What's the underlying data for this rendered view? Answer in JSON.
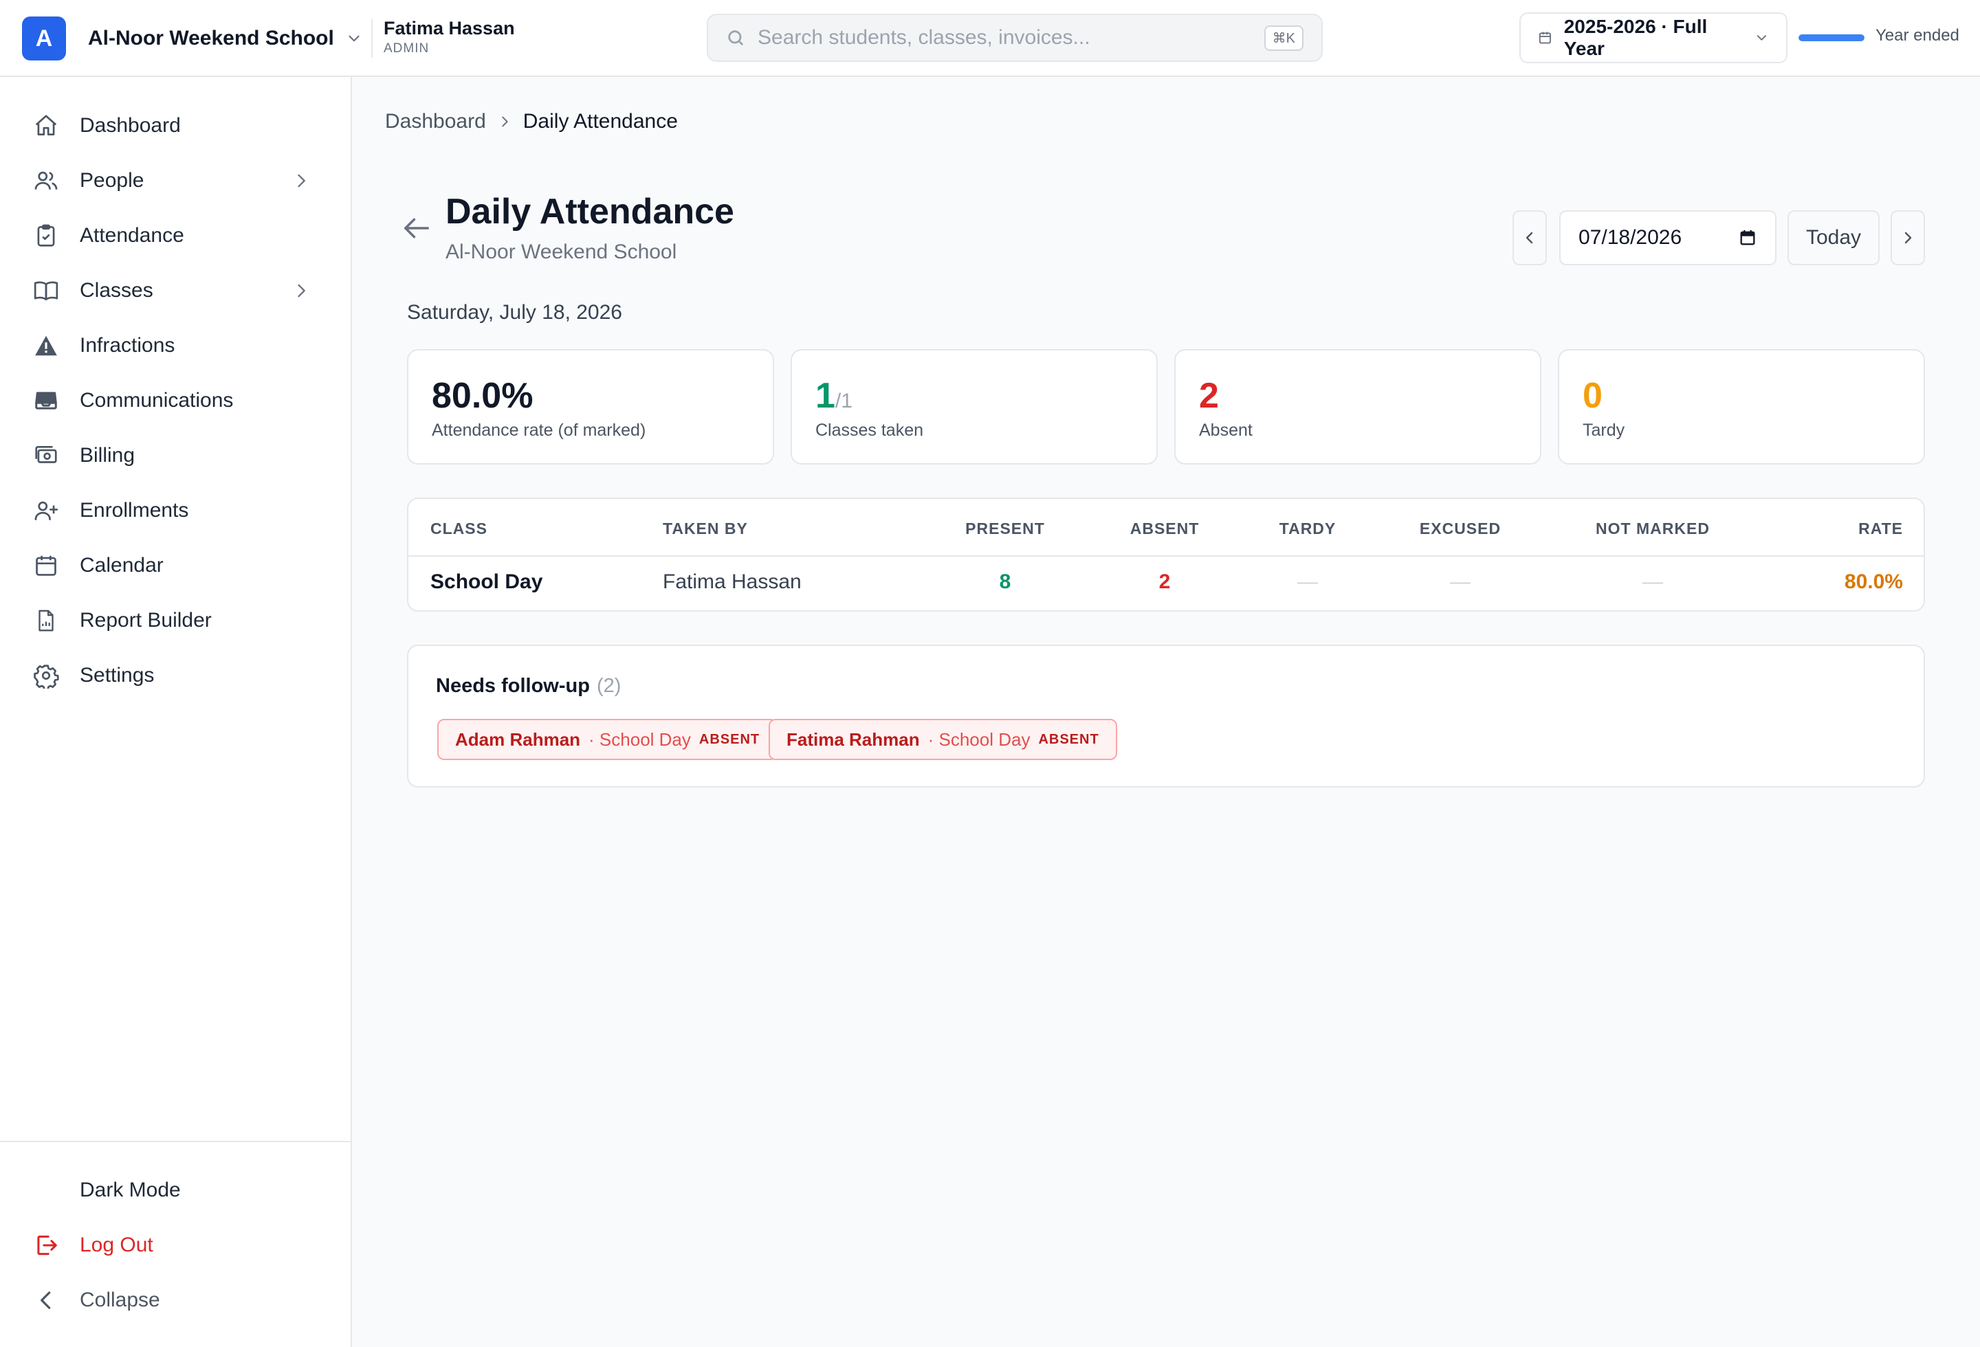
{
  "app": {
    "logo_letter": "A",
    "school_name": "Al-Noor Weekend School",
    "user_name": "Fatima Hassan",
    "user_role": "ADMIN",
    "search_placeholder": "Search students, classes, invoices...",
    "search_shortcut": "⌘K",
    "year_label": "2025-2026 · Full Year",
    "year_progress": 1.0,
    "year_status": "Year ended",
    "accent_color": "#2563eb"
  },
  "sidebar": {
    "items": [
      {
        "label": "Dashboard",
        "icon": "home-icon"
      },
      {
        "label": "People",
        "icon": "users-icon",
        "has_submenu": true
      },
      {
        "label": "Attendance",
        "icon": "clipboard-check-icon"
      },
      {
        "label": "Classes",
        "icon": "book-icon",
        "has_submenu": true
      },
      {
        "label": "Infractions",
        "icon": "warning-icon"
      },
      {
        "label": "Communications",
        "icon": "inbox-icon"
      },
      {
        "label": "Billing",
        "icon": "money-icon"
      },
      {
        "label": "Enrollments",
        "icon": "user-plus-icon"
      },
      {
        "label": "Calendar",
        "icon": "calendar-icon"
      },
      {
        "label": "Report Builder",
        "icon": "report-icon"
      },
      {
        "label": "Settings",
        "icon": "gear-icon"
      }
    ],
    "bottom": {
      "dark_mode": "Dark Mode",
      "logout": "Log Out",
      "collapse": "Collapse"
    }
  },
  "breadcrumb": {
    "parent": "Dashboard",
    "current": "Daily Attendance"
  },
  "header": {
    "title": "Daily Attendance",
    "subtitle": "Al-Noor Weekend School",
    "date_value": "07/18/2026",
    "today_label": "Today",
    "date_long": "Saturday, July 18, 2026"
  },
  "stats": {
    "rate": {
      "value": "80.0%",
      "label": "Attendance rate (of marked)"
    },
    "classes": {
      "value": "1",
      "denominator": "/1",
      "label": "Classes taken"
    },
    "absent": {
      "value": "2",
      "label": "Absent"
    },
    "tardy": {
      "value": "0",
      "label": "Tardy"
    }
  },
  "table": {
    "columns": [
      "CLASS",
      "TAKEN BY",
      "PRESENT",
      "ABSENT",
      "TARDY",
      "EXCUSED",
      "NOT MARKED",
      "RATE"
    ],
    "rows": [
      {
        "class": "School Day",
        "taken_by": "Fatima Hassan",
        "present": "8",
        "absent": "2",
        "tardy": "—",
        "excused": "—",
        "not_marked": "—",
        "rate": "80.0%"
      }
    ]
  },
  "follow_up": {
    "title": "Needs follow-up",
    "count": "(2)",
    "items": [
      {
        "name": "Adam Rahman",
        "class": "· School Day",
        "status": "ABSENT"
      },
      {
        "name": "Fatima Rahman",
        "class": "· School Day",
        "status": "ABSENT"
      }
    ]
  }
}
